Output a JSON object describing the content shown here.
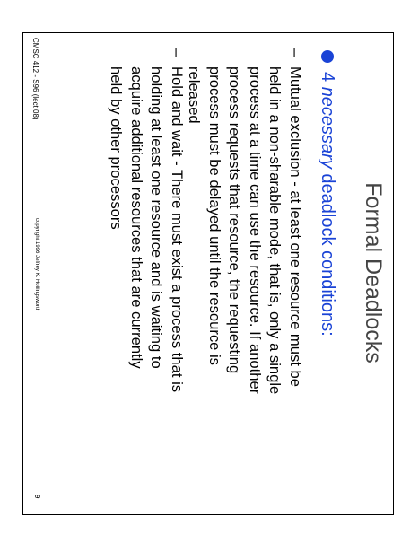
{
  "slide": {
    "title": "Formal Deadlocks",
    "main_bullet_prefix": "4 ",
    "main_bullet_emphasis": "necessary",
    "main_bullet_suffix": " deadlock conditions:",
    "bullet_color": "#1a43d6",
    "conditions": [
      {
        "dash": "–",
        "lines": [
          "Mutual exclusion - at least one resource must be",
          "held in a non-sharable mode, that is, only a single",
          "process at a time can use the resource.  If another",
          "process requests that resource, the requesting",
          "process must be delayed until the resource is",
          "released"
        ]
      },
      {
        "dash": "–",
        "lines": [
          "Hold and wait - There must exist a process that is",
          "holding at least one resource and is waiting to",
          "acquire additional resources that are currently",
          "held by other processors"
        ]
      }
    ],
    "footer": {
      "left": "CMSC 412 - S96 (lect 08)",
      "middle": "copyright 1996 Jeffrey K. Hollingsworth",
      "right": "9"
    }
  }
}
